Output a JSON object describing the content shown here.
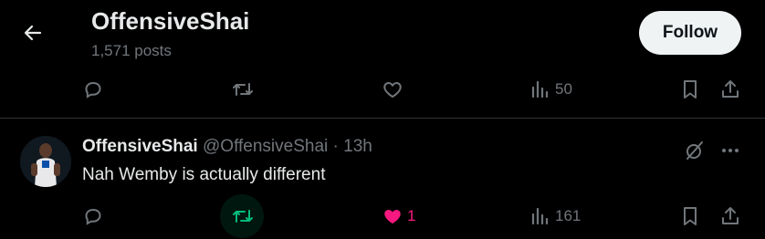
{
  "header": {
    "profile_name": "OffensiveShai",
    "post_count": "1,571 posts",
    "follow_label": "Follow"
  },
  "top_post_actions": {
    "views_count": "50"
  },
  "tweet": {
    "author_name": "OffensiveShai",
    "handle": "@OffensiveShai",
    "separator": "·",
    "time": "13h",
    "text": "Nah Wemby is actually different",
    "like_count": "1",
    "views_count": "161",
    "liked": true,
    "retweeted": true
  },
  "colors": {
    "background": "#000000",
    "text_primary": "#e7e9ea",
    "text_secondary": "#71767b",
    "like_active": "#f91880",
    "retweet_active": "#00ba7c",
    "divider": "#2f3336"
  }
}
